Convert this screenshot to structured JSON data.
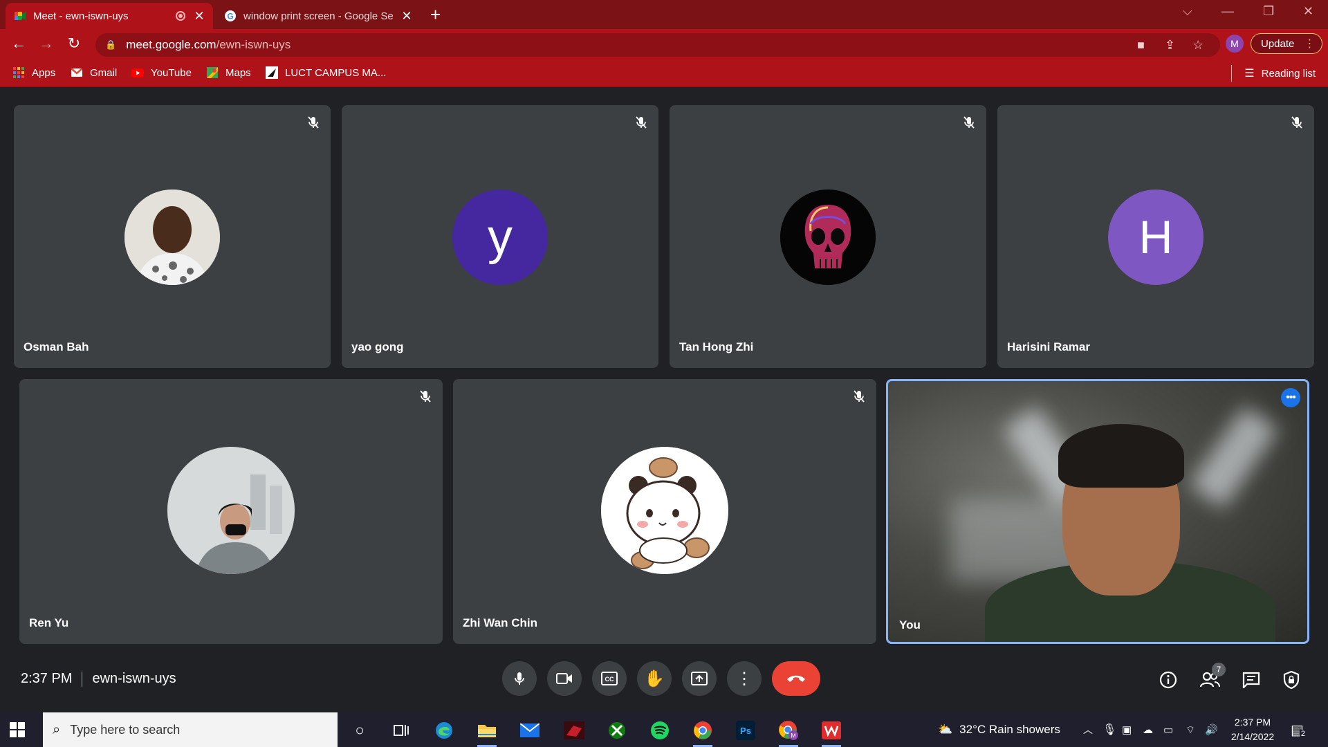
{
  "browser": {
    "tabs": [
      {
        "title": "Meet - ewn-iswn-uys",
        "active": true,
        "recording": true
      },
      {
        "title": "window print screen - Google Se",
        "active": false
      }
    ],
    "url_domain": "meet.google.com",
    "url_path": "/ewn-iswn-uys",
    "profile_initial": "M",
    "update_label": "Update",
    "bookmarks": [
      {
        "label": "Apps",
        "icon": "apps-grid-icon"
      },
      {
        "label": "Gmail",
        "icon": "gmail-icon"
      },
      {
        "label": "YouTube",
        "icon": "youtube-icon"
      },
      {
        "label": "Maps",
        "icon": "maps-icon"
      },
      {
        "label": "LUCT CAMPUS MA...",
        "icon": "luct-icon"
      }
    ],
    "reading_list_label": "Reading list",
    "theme_color": "#b0121a"
  },
  "meeting": {
    "participants": [
      {
        "name": "Osman Bah",
        "avatar": "photo",
        "muted": true
      },
      {
        "name": "yao gong",
        "avatar": "y",
        "avatar_color": "#4527a0",
        "muted": true
      },
      {
        "name": "Tan Hong Zhi",
        "avatar": "skull-photo",
        "muted": true
      },
      {
        "name": "Harisini Ramar",
        "avatar": "H",
        "avatar_color": "#7e57c2",
        "muted": true
      },
      {
        "name": "Ren Yu",
        "avatar": "photo",
        "muted": true
      },
      {
        "name": "Zhi Wan Chin",
        "avatar": "panda-sticker",
        "muted": true
      },
      {
        "name": "You",
        "avatar": "camera",
        "muted": false
      }
    ],
    "time": "2:37 PM",
    "code": "ewn-iswn-uys",
    "people_count": "7"
  },
  "taskbar": {
    "search_placeholder": "Type here to search",
    "weather": "32°C  Rain showers",
    "time": "2:37 PM",
    "date": "2/14/2022",
    "notification_count": "2"
  }
}
